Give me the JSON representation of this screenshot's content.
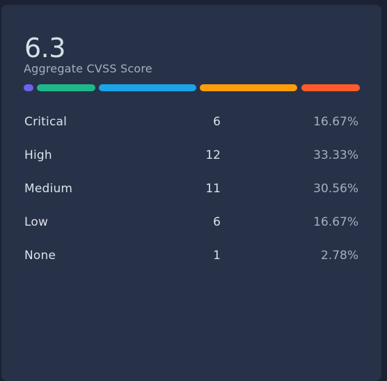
{
  "score": {
    "value": "6.3",
    "label": "Aggregate CVSS Score"
  },
  "distribution": [
    {
      "severity": "None",
      "color": "#6b63ee",
      "fraction": 0.0278
    },
    {
      "severity": "Low",
      "color": "#1db88a",
      "fraction": 0.1667
    },
    {
      "severity": "Medium",
      "color": "#1aa4ea",
      "fraction": 0.3056
    },
    {
      "severity": "High",
      "color": "#ff9d0a",
      "fraction": 0.3333
    },
    {
      "severity": "Critical",
      "color": "#ff5a2c",
      "fraction": 0.1667
    }
  ],
  "rows": [
    {
      "name": "Critical",
      "count": "6",
      "percent": "16.67%"
    },
    {
      "name": "High",
      "count": "12",
      "percent": "33.33%"
    },
    {
      "name": "Medium",
      "count": "11",
      "percent": "30.56%"
    },
    {
      "name": "Low",
      "count": "6",
      "percent": "16.67%"
    },
    {
      "name": "None",
      "count": "1",
      "percent": "2.78%"
    }
  ]
}
